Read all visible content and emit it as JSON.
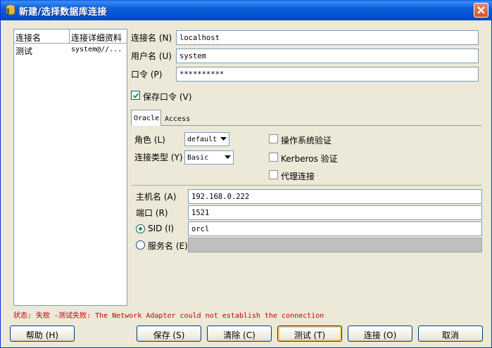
{
  "window": {
    "title": "新建/选择数据库连接"
  },
  "connection_list": {
    "headers": [
      "连接名",
      "连接详细资料"
    ],
    "rows": [
      {
        "name": "测试",
        "detail": "system@//..."
      }
    ]
  },
  "form": {
    "connection_name": {
      "label": "连接名 (N)",
      "value": "localhost"
    },
    "username": {
      "label": "用户名 (U)",
      "value": "system"
    },
    "password": {
      "label": "口令 (P)",
      "value": "**********"
    },
    "save_password": {
      "label": "保存口令 (V)",
      "checked": true
    }
  },
  "tabs": [
    {
      "label": "Oracle",
      "active": true
    },
    {
      "label": "Access",
      "active": false
    }
  ],
  "oracle": {
    "role": {
      "label": "角色 (L)",
      "value": "default"
    },
    "connection_type": {
      "label": "连接类型 (Y)",
      "value": "Basic"
    },
    "os_auth": {
      "label": "操作系统验证",
      "checked": false
    },
    "kerberos_auth": {
      "label": "Kerberos 验证",
      "checked": false
    },
    "proxy_connection": {
      "label": "代理连接",
      "checked": false
    },
    "hostname": {
      "label": "主机名 (A)",
      "value": "192.168.0.222"
    },
    "port": {
      "label": "端口 (R)",
      "value": "1521"
    },
    "sid": {
      "label": "SID (I)",
      "value": "orcl",
      "selected": true
    },
    "service_name": {
      "label": "服务名 (E)",
      "value": "",
      "selected": false
    }
  },
  "status": "状态: 失败 -测试失败: The Network Adapter could not establish the connection",
  "buttons": {
    "help": "帮助 (H)",
    "save": "保存 (S)",
    "clear": "清除 (C)",
    "test": "测试 (T)",
    "connect": "连接 (O)",
    "cancel": "取消"
  },
  "colors": {
    "title_bar": "#0b5fd9",
    "status_error": "#c00000",
    "dialog_bg": "#ece9d8"
  }
}
